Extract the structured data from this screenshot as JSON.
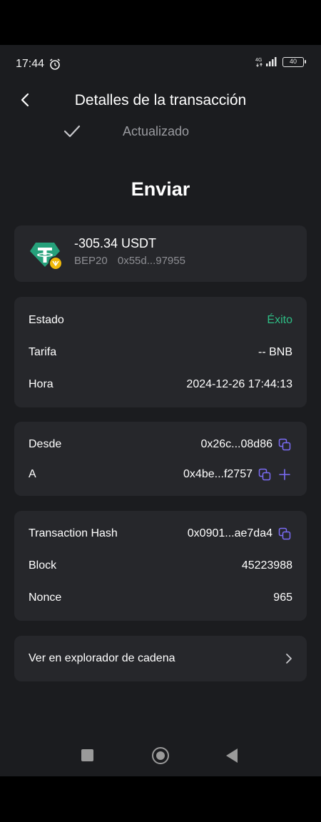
{
  "status_bar": {
    "time": "17:44",
    "network": "4G",
    "battery": "40"
  },
  "header": {
    "title": "Detalles de la transacción"
  },
  "status": {
    "label": "Actualizado"
  },
  "transaction_type": "Enviar",
  "token": {
    "amount": "-305.34 USDT",
    "network": "BEP20",
    "contract": "0x55d...97955"
  },
  "details": {
    "estado_label": "Estado",
    "estado_value": "Éxito",
    "tarifa_label": "Tarifa",
    "tarifa_value": "-- BNB",
    "hora_label": "Hora",
    "hora_value": "2024-12-26 17:44:13"
  },
  "addresses": {
    "from_label": "Desde",
    "from_value": "0x26c...08d86",
    "to_label": "A",
    "to_value": "0x4be...f2757"
  },
  "chain_info": {
    "hash_label": "Transaction Hash",
    "hash_value": "0x0901...ae7da4",
    "block_label": "Block",
    "block_value": "45223988",
    "nonce_label": "Nonce",
    "nonce_value": "965"
  },
  "explorer": {
    "label": "Ver en explorador de cadena"
  },
  "colors": {
    "success": "#2ebd85",
    "accent": "#7b6cf6",
    "tether": "#26a17b",
    "bnb": "#f0b90b"
  }
}
